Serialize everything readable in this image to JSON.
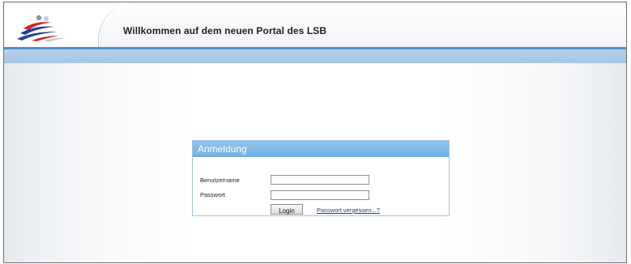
{
  "header": {
    "title": "Willkommen auf dem neuen Portal des LSB",
    "logo_icon": "lsb-logo-icon"
  },
  "login": {
    "heading": "Anmeldung",
    "username_label": "Benutzername",
    "username_value": "",
    "password_label": "Passwort",
    "password_value": "",
    "login_button": "Login",
    "forgot_link": "Passwort vergessen...?"
  },
  "colors": {
    "accent_blue": "#4f8fd0",
    "bar_blue": "#a7c5e3",
    "login_header": "#75b0df",
    "logo_blue": "#1f3f9a",
    "logo_red": "#d3212a"
  }
}
